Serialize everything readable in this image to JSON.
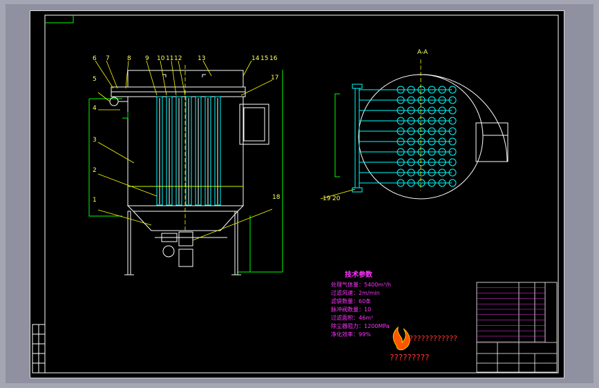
{
  "part_labels": [
    "6",
    "7",
    "8",
    "9",
    "10",
    "11",
    "12",
    "13",
    "14",
    "15",
    "16",
    "17",
    "5",
    "4",
    "3",
    "2",
    "1",
    "18",
    "19",
    "20"
  ],
  "section_label": "A-A",
  "tech": {
    "title": "技术参数",
    "lines": [
      "处理气体量：5400m³/h",
      "过滤风速：2m/min",
      "滤袋数量：60条",
      "脉冲阀数量：10",
      "过滤面积：46m²",
      "除尘器阻力：1200MPa",
      "净化效率：99%"
    ]
  },
  "logo": {
    "top_text": "????????????",
    "bottom_text": "?????????"
  },
  "colors": {
    "outline": "#00ff00",
    "structure": "#ffffff",
    "annotation": "#ffff00",
    "text": "#ff33ff",
    "pipe": "#00ffff"
  }
}
